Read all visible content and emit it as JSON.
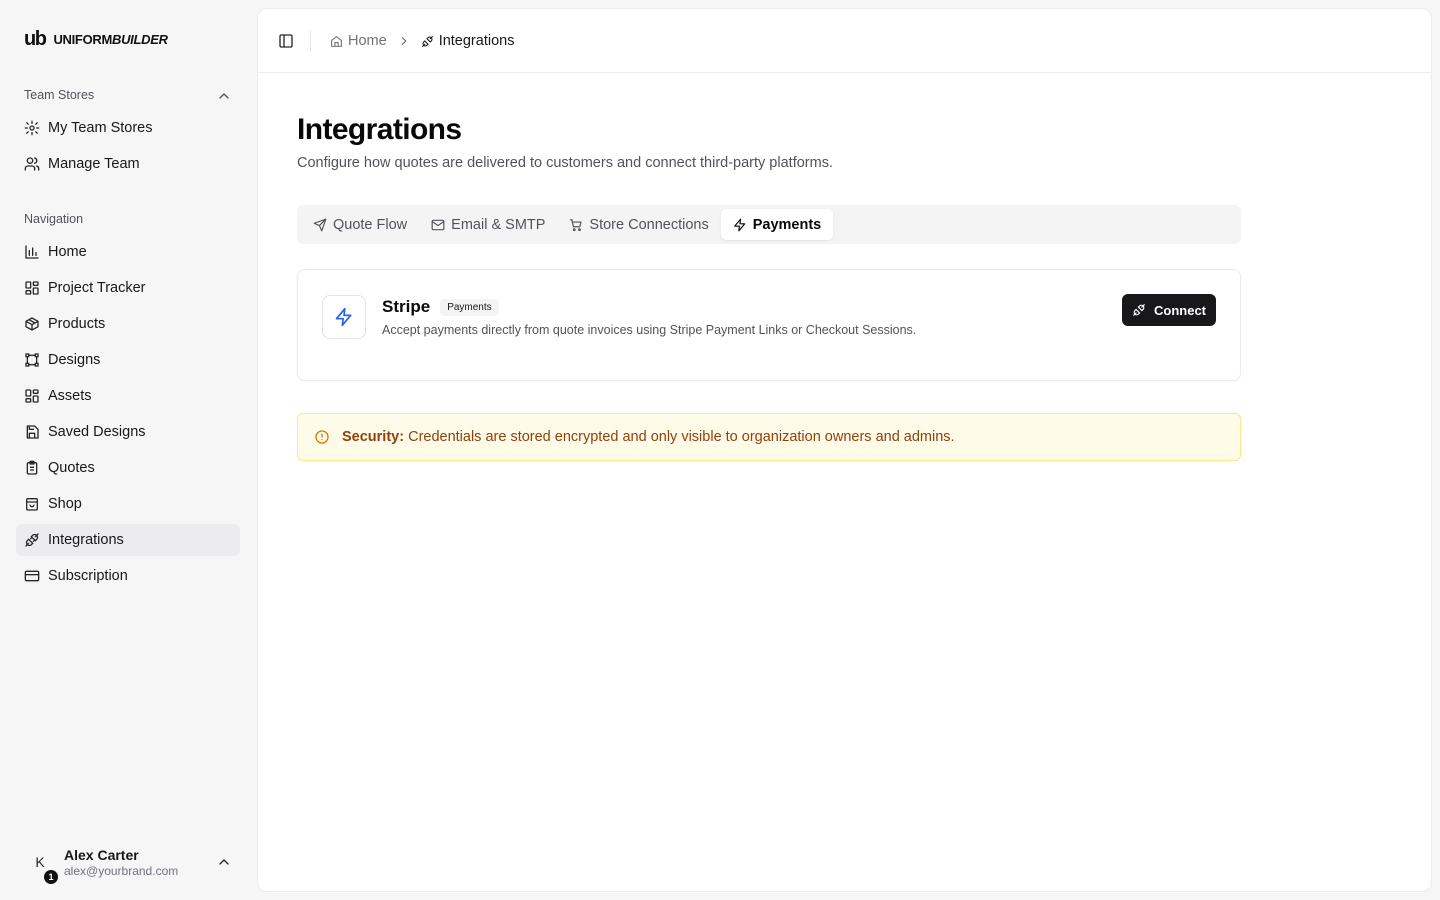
{
  "brand": {
    "mark": "ub",
    "name_plain": "UNIFORM",
    "name_italic": "BUILDER"
  },
  "sidebar": {
    "team_group": {
      "label": "Team Stores",
      "items": [
        {
          "label": "My Team Stores",
          "icon": "gear-icon"
        },
        {
          "label": "Manage Team",
          "icon": "users-icon"
        }
      ]
    },
    "nav_group": {
      "label": "Navigation",
      "items": [
        {
          "label": "Home",
          "icon": "bar-chart-icon"
        },
        {
          "label": "Project Tracker",
          "icon": "grid-icon"
        },
        {
          "label": "Products",
          "icon": "package-icon"
        },
        {
          "label": "Designs",
          "icon": "vector-icon"
        },
        {
          "label": "Assets",
          "icon": "grid-icon"
        },
        {
          "label": "Saved Designs",
          "icon": "save-icon"
        },
        {
          "label": "Quotes",
          "icon": "clipboard-icon"
        },
        {
          "label": "Shop",
          "icon": "store-icon"
        },
        {
          "label": "Integrations",
          "icon": "plug-icon",
          "active": true
        },
        {
          "label": "Subscription",
          "icon": "credit-card-icon"
        }
      ]
    },
    "user": {
      "initial": "K",
      "badge": "1",
      "name": "Alex Carter",
      "email": "alex@yourbrand.com"
    }
  },
  "breadcrumb": {
    "home": "Home",
    "current": "Integrations"
  },
  "page": {
    "title": "Integrations",
    "subtitle": "Configure how quotes are delivered to customers and connect third-party platforms."
  },
  "tabs": [
    {
      "label": "Quote Flow",
      "icon": "send-icon"
    },
    {
      "label": "Email & SMTP",
      "icon": "mail-icon"
    },
    {
      "label": "Store Connections",
      "icon": "cart-icon"
    },
    {
      "label": "Payments",
      "icon": "zap-icon",
      "active": true
    }
  ],
  "integration_card": {
    "title": "Stripe",
    "badge": "Payments",
    "description": "Accept payments directly from quote invoices using Stripe Payment Links or Checkout Sessions.",
    "button": "Connect",
    "icon": "zap-icon",
    "icon_color": "#2563eb"
  },
  "alert": {
    "label": "Security:",
    "text": "Credentials are stored encrypted and only visible to organization owners and admins.",
    "icon": "alert-circle-icon",
    "color": "#92400e"
  }
}
